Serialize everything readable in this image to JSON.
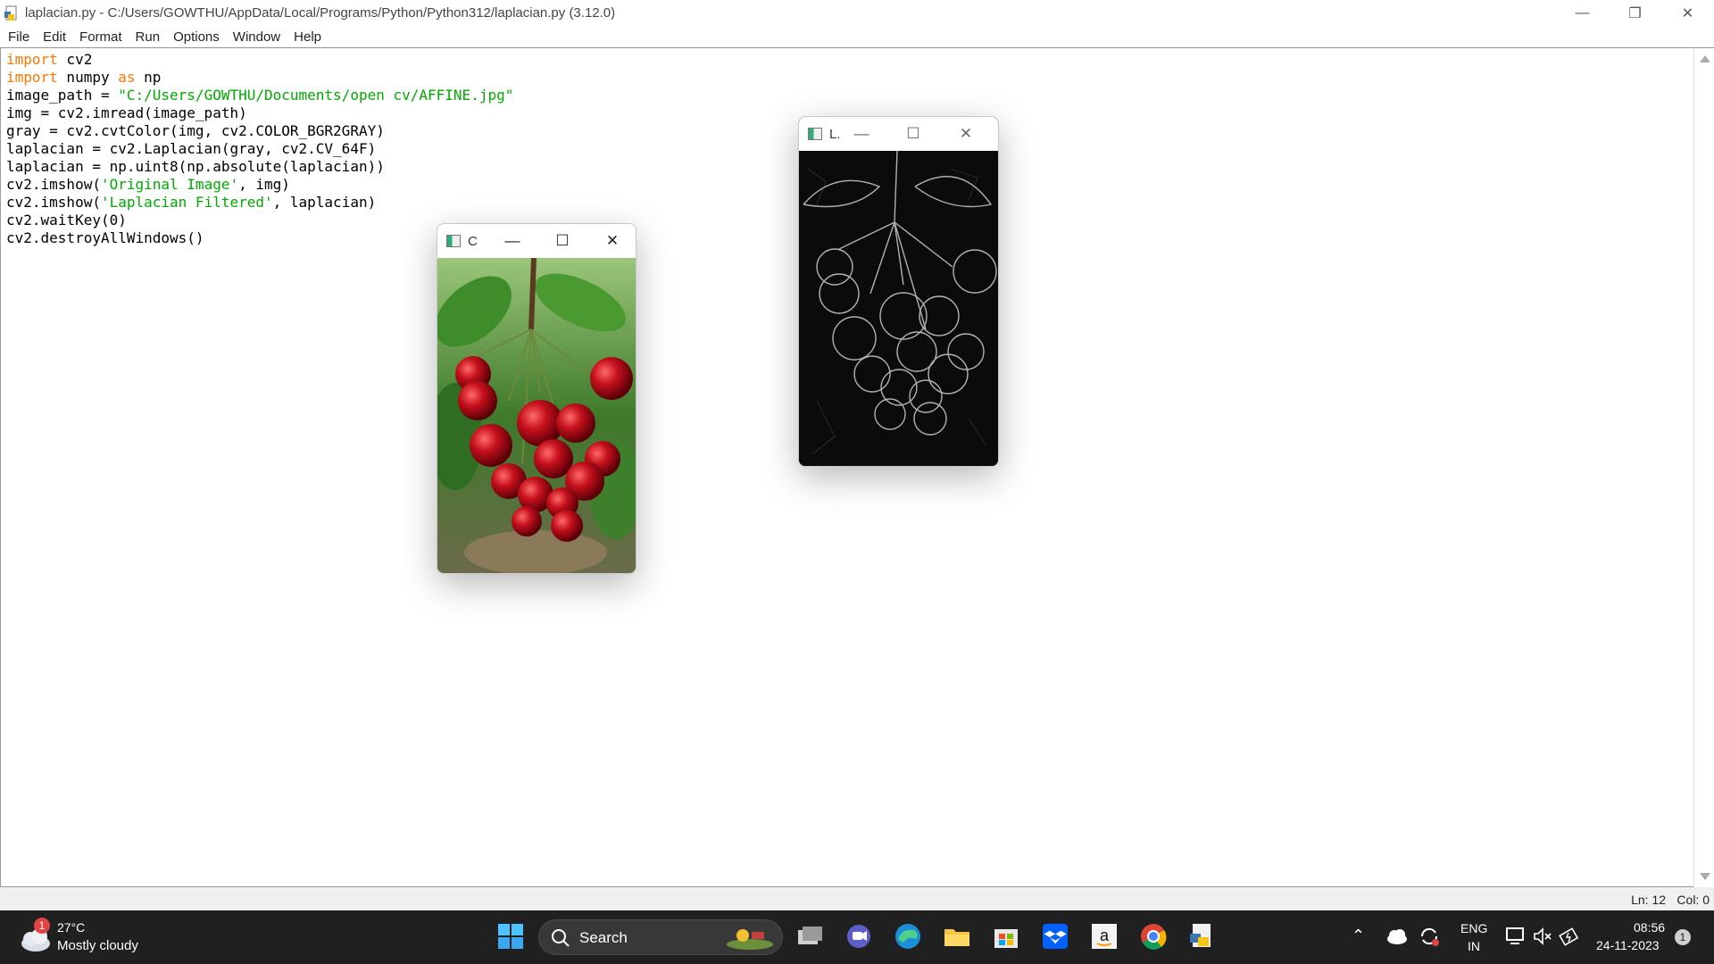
{
  "window": {
    "title": "laplacian.py - C:/Users/GOWTHU/AppData/Local/Programs/Python/Python312/laplacian.py (3.12.0)",
    "minimize": "—",
    "maximize": "❐",
    "close": "✕"
  },
  "menu": [
    "File",
    "Edit",
    "Format",
    "Run",
    "Options",
    "Window",
    "Help"
  ],
  "code": {
    "line1_kw": "import",
    "line1_rest": " cv2",
    "line2_kw": "import",
    "line2_mid": " numpy ",
    "line2_kw2": "as",
    "line2_rest": " np",
    "line3_pre": "image_path = ",
    "line3_str": "\"C:/Users/GOWTHU/Documents/open cv/AFFINE.jpg\"",
    "line4": "img = cv2.imread(image_path)",
    "line5": "gray = cv2.cvtColor(img, cv2.COLOR_BGR2GRAY)",
    "line6": "laplacian = cv2.Laplacian(gray, cv2.CV_64F)",
    "line7": "laplacian = np.uint8(np.absolute(laplacian))",
    "line8_pre": "cv2.imshow(",
    "line8_str": "'Original Image'",
    "line8_post": ", img)",
    "line9_pre": "cv2.imshow(",
    "line9_str": "'Laplacian Filtered'",
    "line9_post": ", laplacian)",
    "line10": "cv2.waitKey(0)",
    "line11": "cv2.destroyAllWindows()"
  },
  "status": {
    "ln": "Ln: 12",
    "col": "Col: 0"
  },
  "cv_windows": {
    "original": {
      "title": "C"
    },
    "laplacian": {
      "title": "L."
    }
  },
  "taskbar": {
    "weather_temp": "27°C",
    "weather_desc": "Mostly cloudy",
    "weather_badge": "1",
    "search_label": "Search",
    "lang_top": "ENG",
    "lang_bottom": "IN",
    "time": "08:56",
    "date": "24-11-2023",
    "notif_count": "1"
  },
  "colors": {
    "keyword": "#ff7700",
    "string": "#00aa00",
    "taskbar_bg": "#202020"
  }
}
